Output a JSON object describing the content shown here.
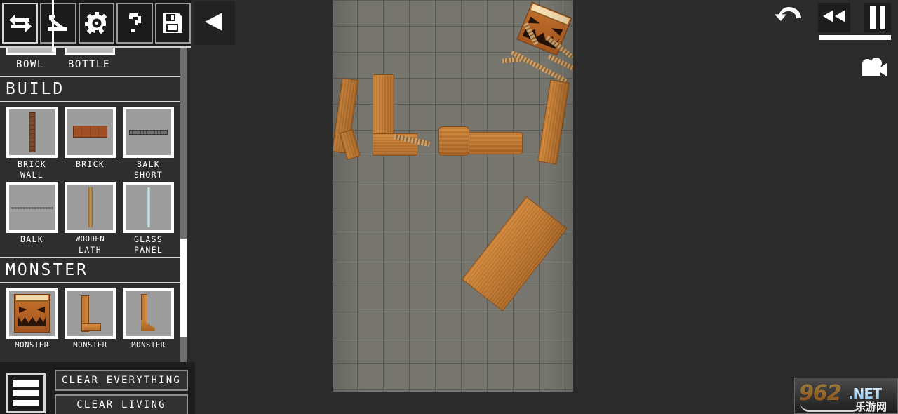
{
  "toolbar": {
    "buttons": [
      {
        "name": "swap-tool",
        "icon": "swap-arrows-icon",
        "selected": true
      },
      {
        "name": "drag-tool",
        "icon": "drag-hand-icon",
        "selected": false
      },
      {
        "name": "settings-tool",
        "icon": "gear-icon",
        "selected": false
      },
      {
        "name": "help-tool",
        "icon": "question-mark-icon",
        "selected": false
      },
      {
        "name": "save-tool",
        "icon": "floppy-disk-icon",
        "selected": false
      }
    ],
    "back_icon": "back-triangle-icon"
  },
  "sidebar": {
    "partial_items": [
      {
        "label": "BOWL"
      },
      {
        "label": "BOTTLE"
      }
    ],
    "sections": [
      {
        "title": "BUILD",
        "items": [
          {
            "label": "BRICK\nWALL",
            "label_line1": "BRICK",
            "label_line2": "WALL",
            "art": "brick-wall"
          },
          {
            "label": "BRICK",
            "label_line1": "BRICK",
            "label_line2": "",
            "art": "brick"
          },
          {
            "label": "BALK\nSHORT",
            "label_line1": "BALK",
            "label_line2": "SHORT",
            "art": "balk-short"
          },
          {
            "label": "BALK",
            "label_line1": "BALK",
            "label_line2": "",
            "art": "balk"
          },
          {
            "label": "WOODEN\nLATH",
            "label_line1": "WOODEN",
            "label_line2": "LATH",
            "art": "wooden-lath"
          },
          {
            "label": "GLASS\nPANEL",
            "label_line1": "GLASS",
            "label_line2": "PANEL",
            "art": "glass-panel"
          }
        ]
      },
      {
        "title": "MONSTER",
        "items": [
          {
            "label": "MONSTER",
            "art": "monster-head"
          },
          {
            "label": "MONSTER",
            "art": "monster-l"
          },
          {
            "label": "MONSTER",
            "art": "monster-j"
          }
        ]
      }
    ]
  },
  "bottom": {
    "menu_icon": "hamburger-menu-icon",
    "clear_everything_label": "CLEAR EVERYTHING",
    "clear_living_label": "CLEAR LIVING"
  },
  "right_controls": {
    "undo_icon": "undo-arrow-icon",
    "rewind_icon": "rewind-icon",
    "pause_icon": "pause-icon",
    "camera_icon": "video-camera-icon",
    "speed_bar_value": "100"
  },
  "watermark": {
    "number": "962",
    "tld": ".NET",
    "chinese": "乐游网"
  },
  "stage": {
    "grid_size": "37",
    "background_color": "#76766f",
    "objects": [
      {
        "name": "monster-head",
        "type": "head"
      },
      {
        "name": "monster-body-plank",
        "type": "plank"
      },
      {
        "name": "monster-arm-rope",
        "type": "rope"
      },
      {
        "name": "fallen-plank-left",
        "type": "plank"
      },
      {
        "name": "fallen-plank-l-shape",
        "type": "plank"
      },
      {
        "name": "fallen-log",
        "type": "log"
      },
      {
        "name": "fallen-plank-right",
        "type": "plank"
      }
    ]
  }
}
